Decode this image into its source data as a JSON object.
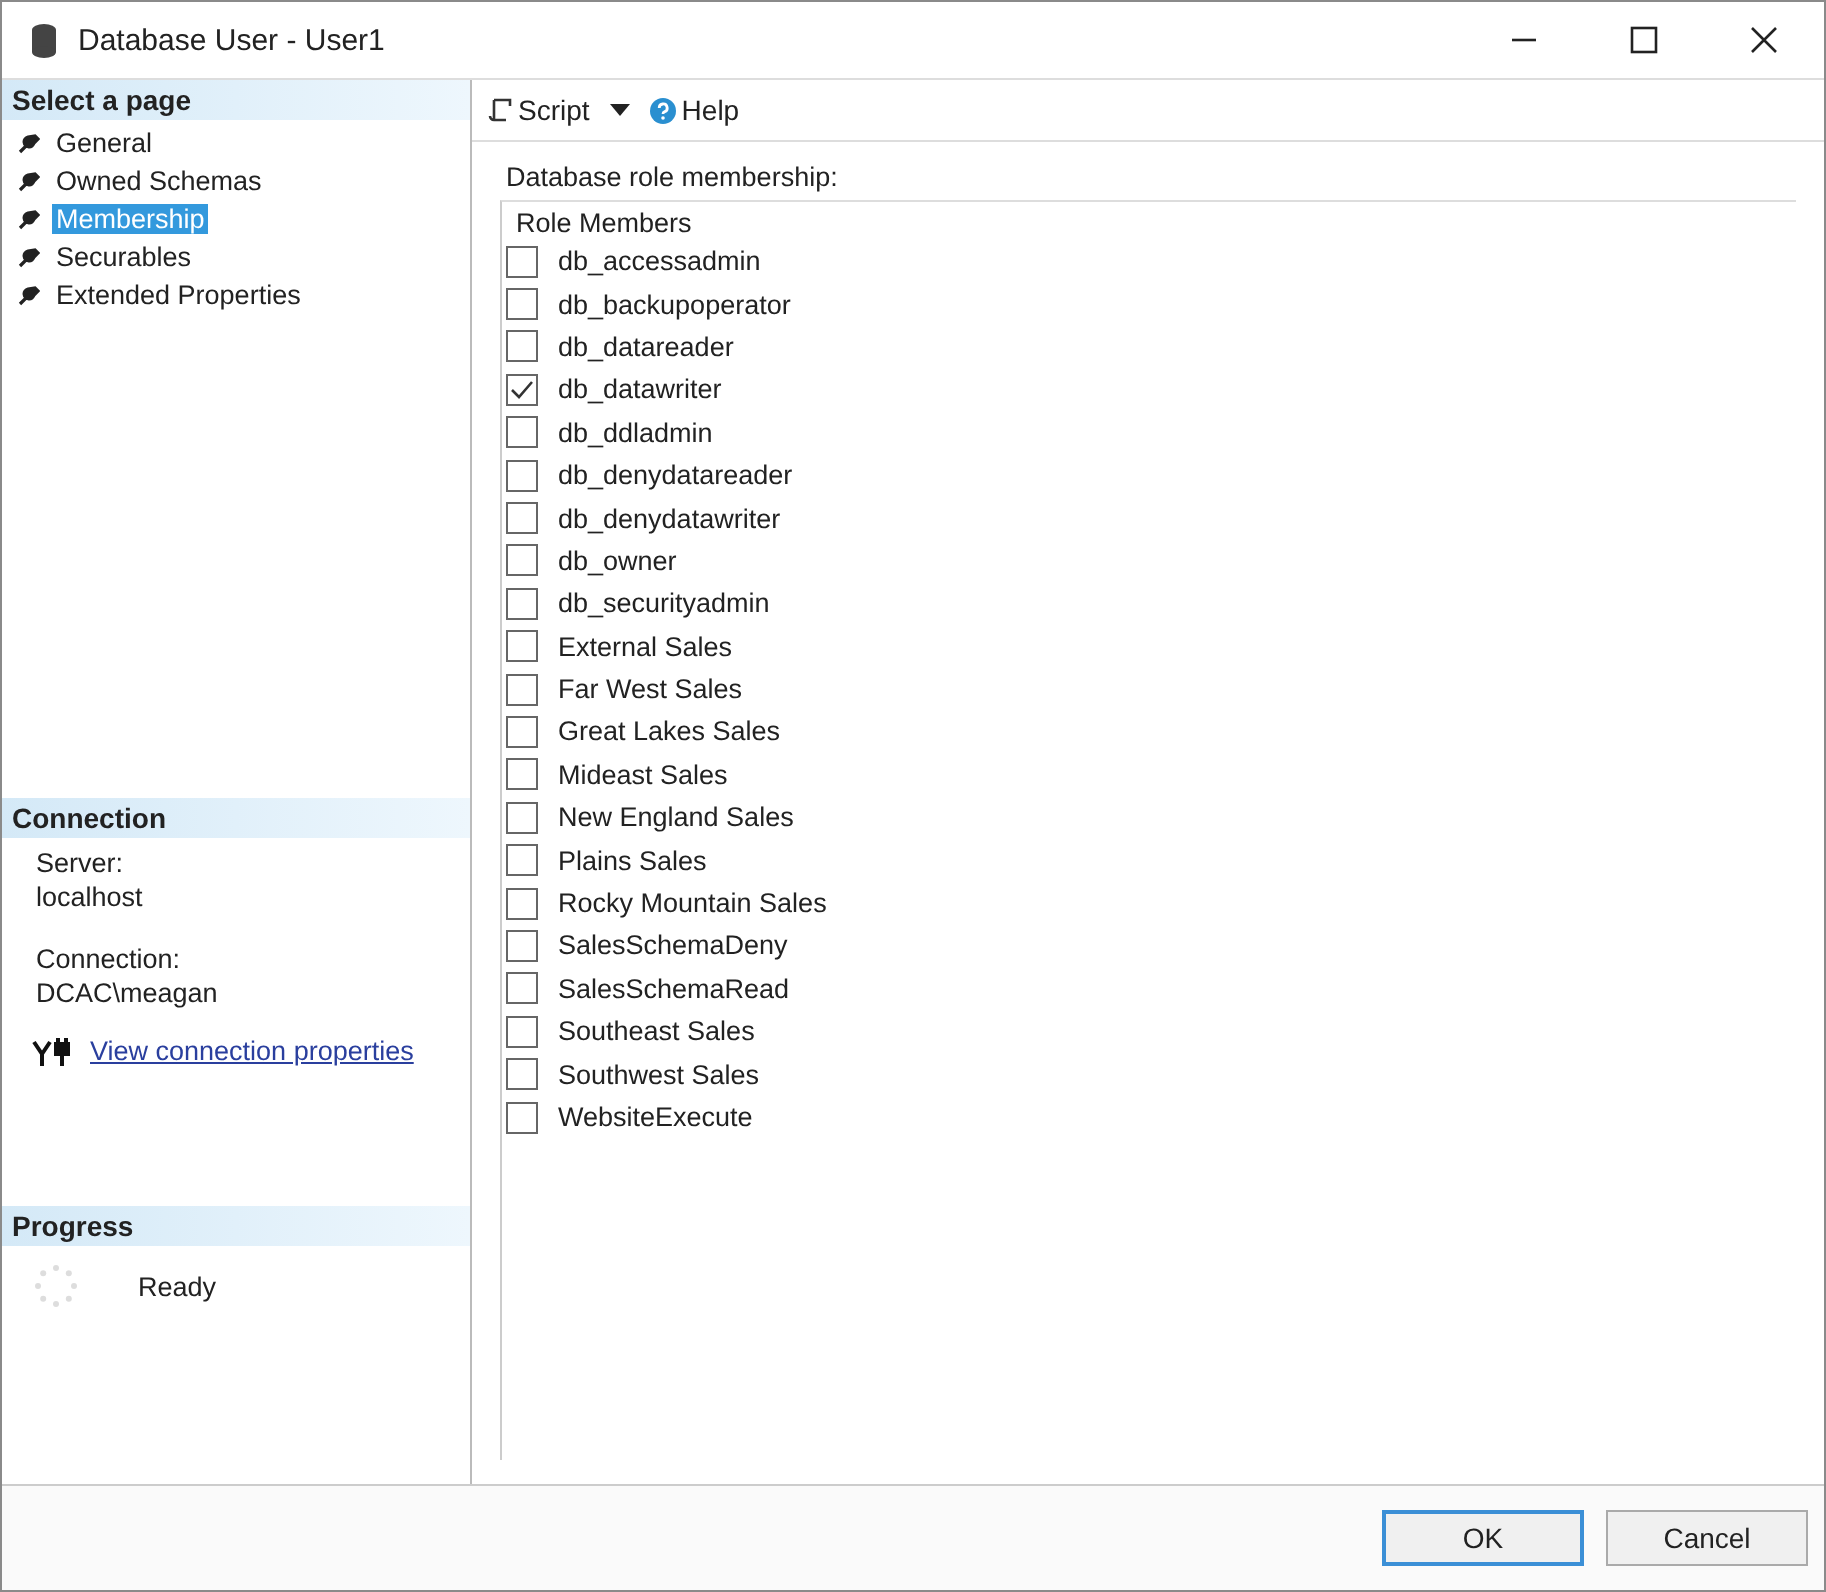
{
  "window": {
    "title": "Database User - User1"
  },
  "sidebar": {
    "header": "Select a page",
    "items": [
      {
        "label": "General",
        "selected": false
      },
      {
        "label": "Owned Schemas",
        "selected": false
      },
      {
        "label": "Membership",
        "selected": true
      },
      {
        "label": "Securables",
        "selected": false
      },
      {
        "label": "Extended Properties",
        "selected": false
      }
    ]
  },
  "connection": {
    "header": "Connection",
    "server_label": "Server:",
    "server": "localhost",
    "connection_label": "Connection:",
    "connection": "DCAC\\meagan",
    "link": "View connection properties"
  },
  "progress": {
    "header": "Progress",
    "status": "Ready"
  },
  "toolbar": {
    "script": "Script",
    "help": "Help"
  },
  "role_membership": {
    "label": "Database role membership:",
    "column": "Role Members",
    "roles": [
      {
        "name": "db_accessadmin",
        "checked": false
      },
      {
        "name": "db_backupoperator",
        "checked": false
      },
      {
        "name": "db_datareader",
        "checked": false
      },
      {
        "name": "db_datawriter",
        "checked": true
      },
      {
        "name": "db_ddladmin",
        "checked": false
      },
      {
        "name": "db_denydatareader",
        "checked": false
      },
      {
        "name": "db_denydatawriter",
        "checked": false
      },
      {
        "name": "db_owner",
        "checked": false
      },
      {
        "name": "db_securityadmin",
        "checked": false
      },
      {
        "name": "External Sales",
        "checked": false
      },
      {
        "name": "Far West Sales",
        "checked": false
      },
      {
        "name": "Great Lakes Sales",
        "checked": false
      },
      {
        "name": "Mideast Sales",
        "checked": false
      },
      {
        "name": "New England Sales",
        "checked": false
      },
      {
        "name": "Plains Sales",
        "checked": false
      },
      {
        "name": "Rocky Mountain Sales",
        "checked": false
      },
      {
        "name": "SalesSchemaDeny",
        "checked": false
      },
      {
        "name": "SalesSchemaRead",
        "checked": false
      },
      {
        "name": "Southeast Sales",
        "checked": false
      },
      {
        "name": "Southwest Sales",
        "checked": false
      },
      {
        "name": "WebsiteExecute",
        "checked": false
      }
    ]
  },
  "buttons": [
    "OK",
    "Cancel"
  ]
}
